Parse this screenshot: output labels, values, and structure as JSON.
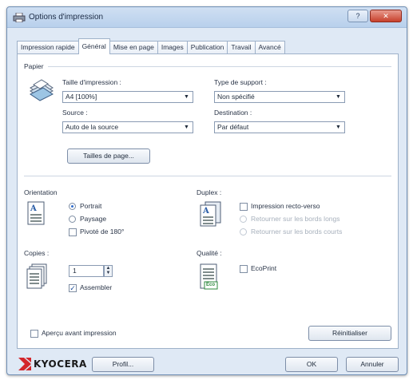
{
  "window": {
    "title": "Options d'impression",
    "help_button": "?",
    "close_button": "✕"
  },
  "tabs": [
    {
      "label": "Impression rapide"
    },
    {
      "label": "Général"
    },
    {
      "label": "Mise en page"
    },
    {
      "label": "Images"
    },
    {
      "label": "Publication"
    },
    {
      "label": "Travail"
    },
    {
      "label": "Avancé"
    }
  ],
  "active_tab": "Général",
  "paper": {
    "section_label": "Papier",
    "print_size_label": "Taille d'impression :",
    "print_size_value": "A4 [100%]",
    "source_label": "Source :",
    "source_value": "Auto de la source",
    "media_type_label": "Type de support :",
    "media_type_value": "Non spécifié",
    "destination_label": "Destination :",
    "destination_value": "Par défaut",
    "page_sizes_button": "Tailles de page..."
  },
  "orientation": {
    "section_label": "Orientation",
    "portrait_label": "Portrait",
    "landscape_label": "Paysage",
    "rotate_label": "Pivoté de 180°",
    "selected": "Portrait",
    "rotate_checked": false
  },
  "duplex": {
    "section_label": "Duplex :",
    "two_sided_label": "Impression recto-verso",
    "long_edge_label": "Retourner sur les bords longs",
    "short_edge_label": "Retourner sur les bords courts",
    "two_sided_checked": false
  },
  "copies": {
    "section_label": "Copies :",
    "value": "1",
    "collate_label": "Assembler",
    "collate_checked": true
  },
  "quality": {
    "section_label": "Qualité :",
    "ecoprint_label": "EcoPrint",
    "ecoprint_checked": false,
    "eco_icon_text": "Eco"
  },
  "preview": {
    "label": "Aperçu avant impression",
    "checked": false
  },
  "buttons": {
    "reset": "Réinitialiser",
    "profile": "Profil...",
    "ok": "OK",
    "cancel": "Annuler"
  },
  "brand": {
    "name": "KYOCERA",
    "color": "#d3262b"
  },
  "icons": {
    "title": "printer-icon",
    "paper": "paper-stack-icon",
    "orientation": "portrait-page-icon",
    "duplex": "duplex-pages-icon",
    "copies": "copies-stack-icon",
    "quality": "eco-page-icon"
  }
}
